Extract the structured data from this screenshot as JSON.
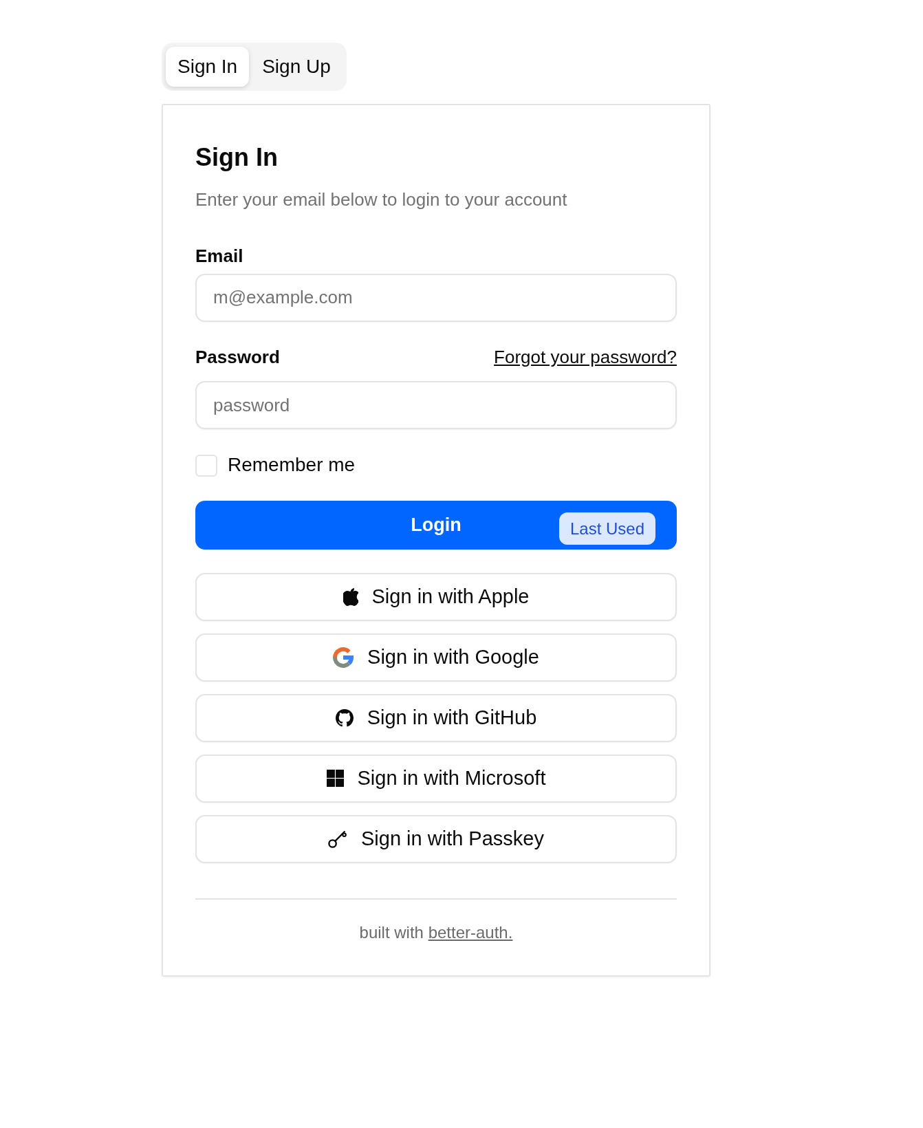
{
  "tabs": [
    {
      "label": "Sign In",
      "selected": true
    },
    {
      "label": "Sign Up",
      "selected": false
    }
  ],
  "card": {
    "title": "Sign In",
    "description": "Enter your email below to login to your account"
  },
  "form": {
    "email": {
      "label": "Email",
      "placeholder": "m@example.com"
    },
    "password": {
      "label": "Password",
      "forgot_link": "Forgot your password?",
      "placeholder": "password"
    },
    "remember": {
      "label": "Remember me",
      "checked": false
    },
    "login_button": {
      "label": "Login",
      "badge": "Last Used"
    }
  },
  "social_buttons": [
    {
      "kind": "apple",
      "label": "Sign in with Apple"
    },
    {
      "kind": "google",
      "label": "Sign in with Google"
    },
    {
      "kind": "github",
      "label": "Sign in with GitHub"
    },
    {
      "kind": "microsoft",
      "label": "Sign in with Microsoft"
    },
    {
      "kind": "passkey",
      "label": "Sign in with Passkey"
    }
  ],
  "footer": {
    "text": "built with",
    "link": "better-auth."
  }
}
